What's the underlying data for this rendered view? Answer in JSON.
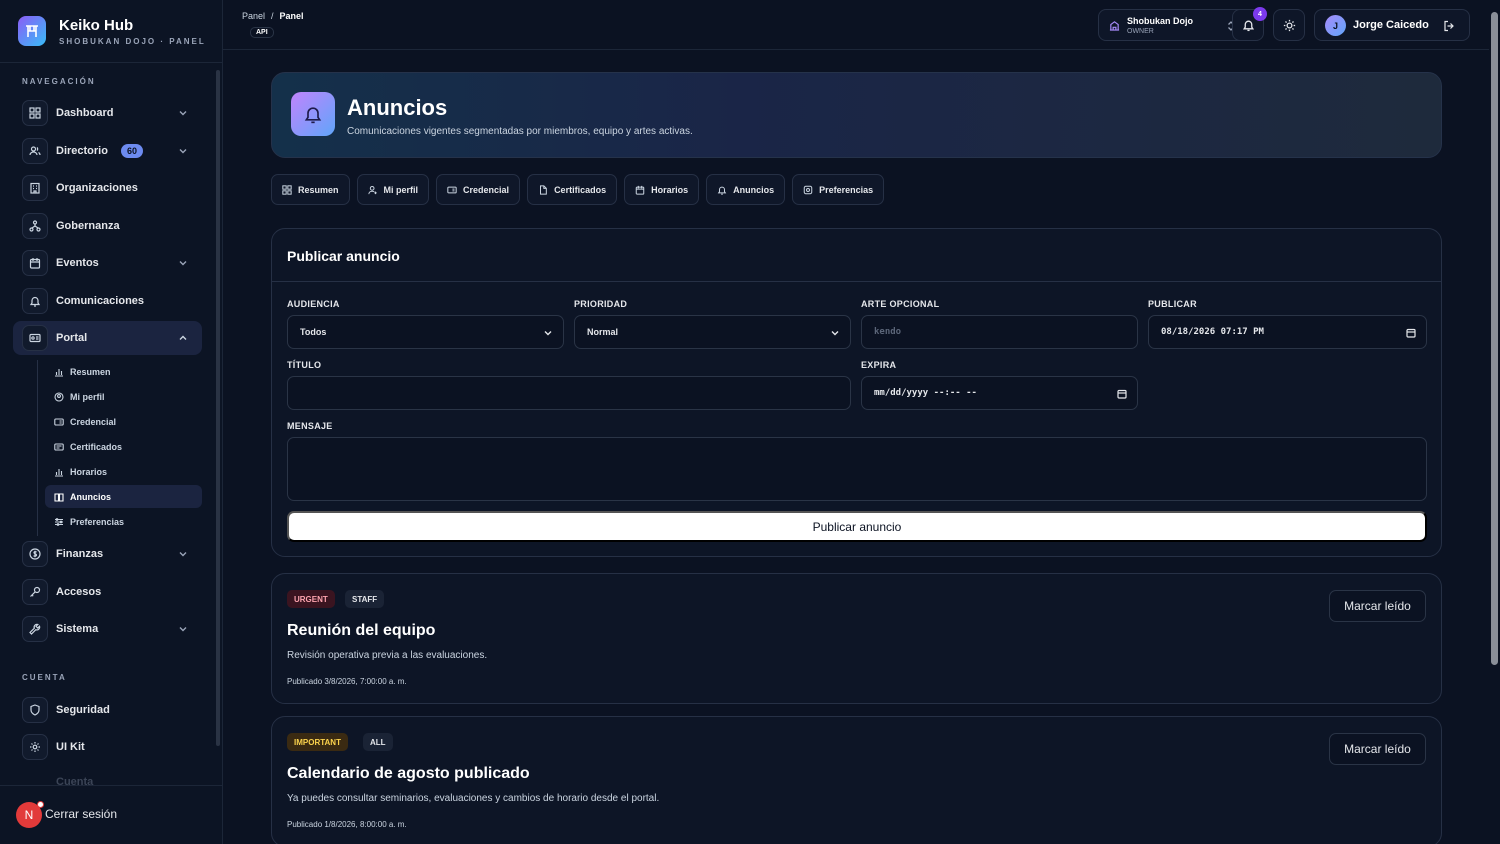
{
  "brand": {
    "title": "Keiko Hub",
    "subtitle": "SHOBUKAN DOJO · PANEL"
  },
  "sidebar": {
    "nav_label": "NAVEGACIÓN",
    "items": [
      {
        "label": "Dashboard"
      },
      {
        "label": "Directorio",
        "badge": "60"
      },
      {
        "label": "Organizaciones"
      },
      {
        "label": "Gobernanza"
      },
      {
        "label": "Eventos"
      },
      {
        "label": "Comunicaciones"
      },
      {
        "label": "Portal"
      },
      {
        "label": "Finanzas"
      },
      {
        "label": "Accesos"
      },
      {
        "label": "Sistema"
      }
    ],
    "portal_subitems": [
      {
        "label": "Resumen"
      },
      {
        "label": "Mi perfil"
      },
      {
        "label": "Credencial"
      },
      {
        "label": "Certificados"
      },
      {
        "label": "Horarios"
      },
      {
        "label": "Anuncios"
      },
      {
        "label": "Preferencias"
      }
    ],
    "account_label": "CUENTA",
    "account_items": [
      {
        "label": "Seguridad"
      },
      {
        "label": "UI Kit"
      },
      {
        "label": "Cuenta"
      }
    ],
    "logout_avatar": "N",
    "logout_label": "Cerrar sesión"
  },
  "topbar": {
    "breadcrumb": [
      "Panel",
      "/",
      "Panel"
    ],
    "api_chip": "API",
    "dojo_name": "Shobukan Dojo",
    "dojo_role": "OWNER",
    "notifications": "4",
    "user_initial": "J",
    "user_name": "Jorge Caicedo"
  },
  "hero": {
    "title": "Anuncios",
    "subtitle": "Comunicaciones vigentes segmentadas por miembros, equipo y artes activas."
  },
  "tabs": [
    {
      "label": "Resumen"
    },
    {
      "label": "Mi perfil"
    },
    {
      "label": "Credencial"
    },
    {
      "label": "Certificados"
    },
    {
      "label": "Horarios"
    },
    {
      "label": "Anuncios"
    },
    {
      "label": "Preferencias"
    }
  ],
  "form": {
    "title": "Publicar anuncio",
    "audience_label": "AUDIENCIA",
    "audience_value": "Todos",
    "priority_label": "PRIORIDAD",
    "priority_value": "Normal",
    "art_label": "ARTE OPCIONAL",
    "art_placeholder": "kendo",
    "publish_label": "PUBLICAR",
    "publish_value": "08/18/2026 07:17 PM",
    "title_label": "TÍTULO",
    "title_value": "",
    "expires_label": "EXPIRA",
    "expires_placeholder": "mm/dd/yyyy --:-- --",
    "message_label": "MENSAJE",
    "submit_label": "Publicar anuncio"
  },
  "announcements": [
    {
      "priority": "URGENT",
      "audience": "STAFF",
      "title": "Reunión del equipo",
      "message": "Revisión operativa previa a las evaluaciones.",
      "date": "Publicado 3/8/2026, 7:00:00 a. m.",
      "action": "Marcar leído"
    },
    {
      "priority": "IMPORTANT",
      "audience": "ALL",
      "title": "Calendario de agosto publicado",
      "message": "Ya puedes consultar seminarios, evaluaciones y cambios de horario desde el portal.",
      "date": "Publicado 1/8/2026, 8:00:00 a. m.",
      "action": "Marcar leído"
    }
  ],
  "colors": {
    "accent": "#7c3aed",
    "badge": "#6d8bf0",
    "urgent": "#fda4af",
    "important": "#fcd34d",
    "background": "#0b1222"
  }
}
